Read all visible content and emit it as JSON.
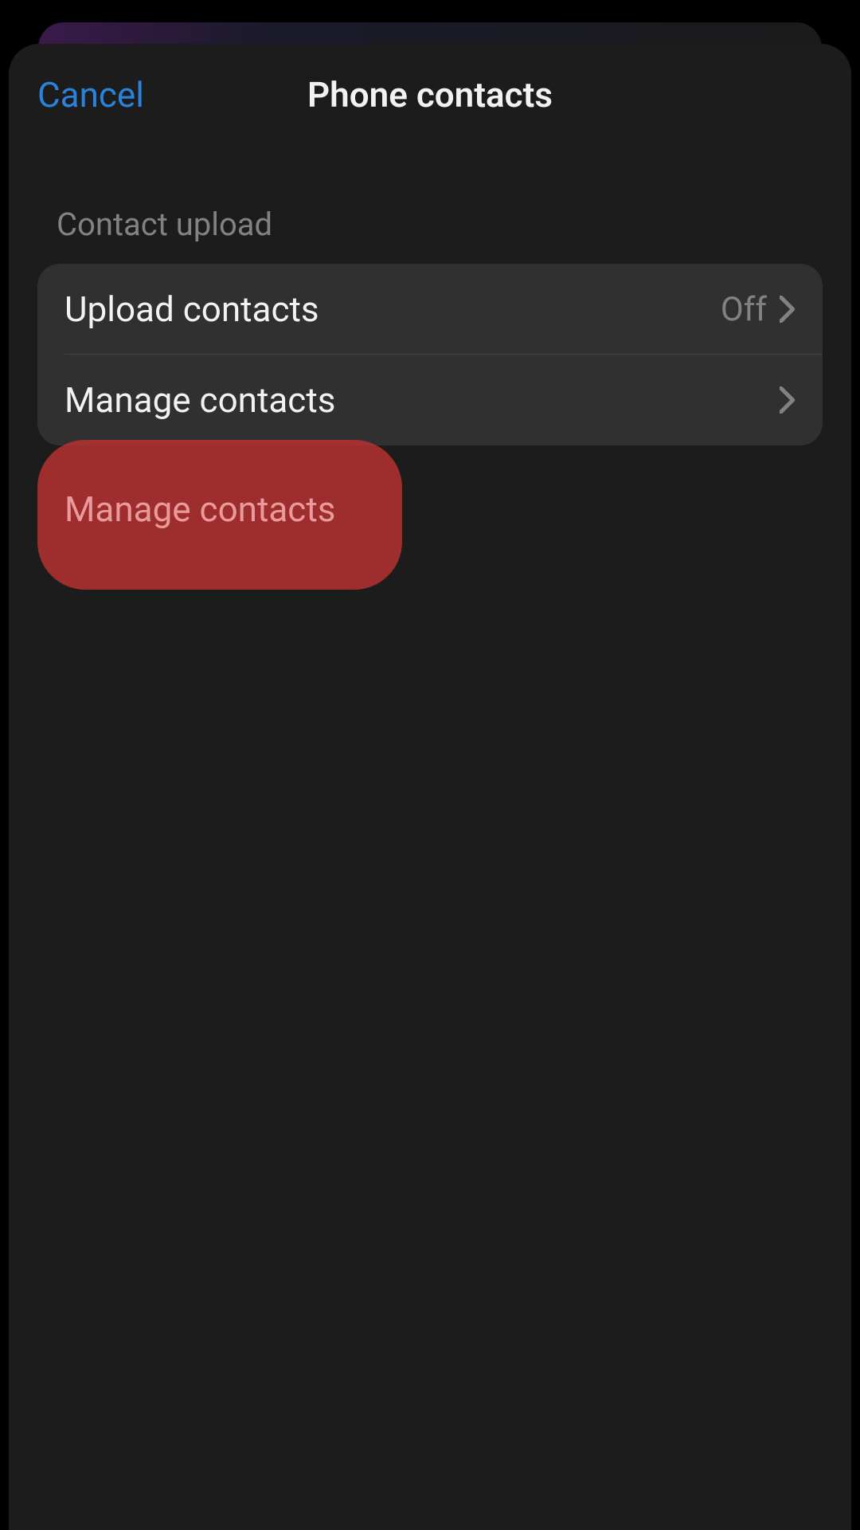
{
  "header": {
    "cancel": "Cancel",
    "title": "Phone contacts"
  },
  "section": {
    "header": "Contact upload"
  },
  "rows": {
    "upload": {
      "label": "Upload contacts",
      "value": "Off"
    },
    "manage": {
      "label": "Manage contacts"
    }
  },
  "colors": {
    "accent": "#2f88e6",
    "highlight": "#c33232"
  }
}
